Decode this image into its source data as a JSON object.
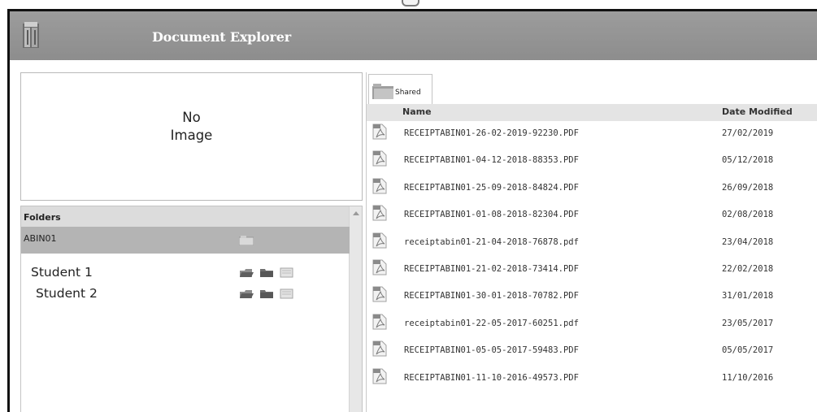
{
  "window": {
    "title": "Document Explorer"
  },
  "preview": {
    "line1": "No",
    "line2": "Image"
  },
  "folders": {
    "header": "Folders",
    "root": "ABIN01",
    "items": [
      {
        "label": "Student 1"
      },
      {
        "label": "Student 2"
      }
    ]
  },
  "files": {
    "tab": "Shared",
    "columns": {
      "name": "Name",
      "date": "Date Modified"
    },
    "rows": [
      {
        "name": "RECEIPTABIN01-26-02-2019-92230.PDF",
        "date": "27/02/2019"
      },
      {
        "name": "RECEIPTABIN01-04-12-2018-88353.PDF",
        "date": "05/12/2018"
      },
      {
        "name": "RECEIPTABIN01-25-09-2018-84824.PDF",
        "date": "26/09/2018"
      },
      {
        "name": "RECEIPTABIN01-01-08-2018-82304.PDF",
        "date": "02/08/2018"
      },
      {
        "name": "receiptabin01-21-04-2018-76878.pdf",
        "date": "23/04/2018"
      },
      {
        "name": "RECEIPTABIN01-21-02-2018-73414.PDF",
        "date": "22/02/2018"
      },
      {
        "name": "RECEIPTABIN01-30-01-2018-70782.PDF",
        "date": "31/01/2018"
      },
      {
        "name": "receiptabin01-22-05-2017-60251.pdf",
        "date": "23/05/2017"
      },
      {
        "name": "RECEIPTABIN01-05-05-2017-59483.PDF",
        "date": "05/05/2017"
      },
      {
        "name": "RECEIPTABIN01-11-10-2016-49573.PDF",
        "date": "11/10/2016"
      }
    ]
  },
  "icons": {
    "app": "cabinet-icon",
    "row": "pdf-file-icon",
    "folder_actions": [
      "open-folder-icon",
      "closed-folder-icon",
      "new-document-icon"
    ]
  }
}
